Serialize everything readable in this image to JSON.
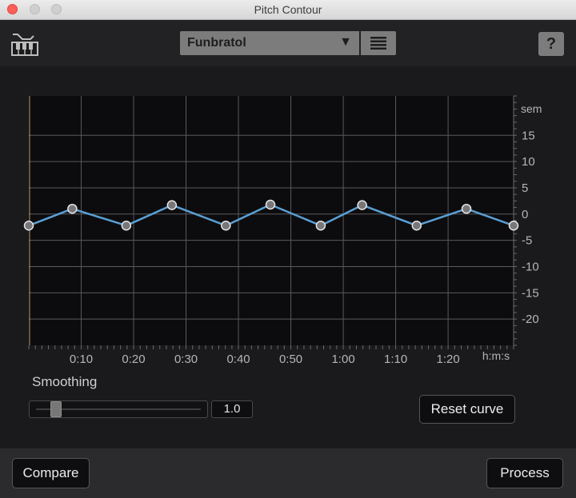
{
  "window": {
    "title": "Pitch Contour"
  },
  "header": {
    "preset_value": "Funbratol",
    "preset_arrow": "▼",
    "help_label": "?"
  },
  "graph": {
    "y_unit": "sem",
    "x_unit": "h:m:s",
    "y_ticks": [
      15,
      10,
      5,
      0,
      -5,
      -10,
      -15,
      -20
    ],
    "y_tick_labels": [
      "15",
      "10",
      "5",
      "0",
      "-5",
      "-10",
      "-15",
      "-20"
    ],
    "x_ticks": [
      10,
      20,
      30,
      40,
      50,
      60,
      70,
      80
    ],
    "x_tick_labels": [
      "0:10",
      "0:20",
      "0:30",
      "0:40",
      "0:50",
      "1:00",
      "1:10",
      "1:20"
    ],
    "x_range": [
      0,
      92.5
    ],
    "y_range": [
      -25,
      22.5
    ],
    "curve_color": "#5a9fd4",
    "points": [
      {
        "t": 0.0,
        "sem": -2.2
      },
      {
        "t": 8.3,
        "sem": 1.0
      },
      {
        "t": 18.6,
        "sem": -2.2
      },
      {
        "t": 27.3,
        "sem": 1.7
      },
      {
        "t": 37.6,
        "sem": -2.2
      },
      {
        "t": 46.1,
        "sem": 1.8
      },
      {
        "t": 55.7,
        "sem": -2.2
      },
      {
        "t": 63.6,
        "sem": 1.7
      },
      {
        "t": 74.0,
        "sem": -2.2
      },
      {
        "t": 83.5,
        "sem": 1.0
      },
      {
        "t": 92.5,
        "sem": -2.2
      }
    ]
  },
  "controls": {
    "smoothing_label": "Smoothing",
    "smoothing_value": "1.0",
    "smoothing_fraction": 0.11,
    "reset_label": "Reset curve"
  },
  "footer": {
    "compare_label": "Compare",
    "process_label": "Process"
  }
}
